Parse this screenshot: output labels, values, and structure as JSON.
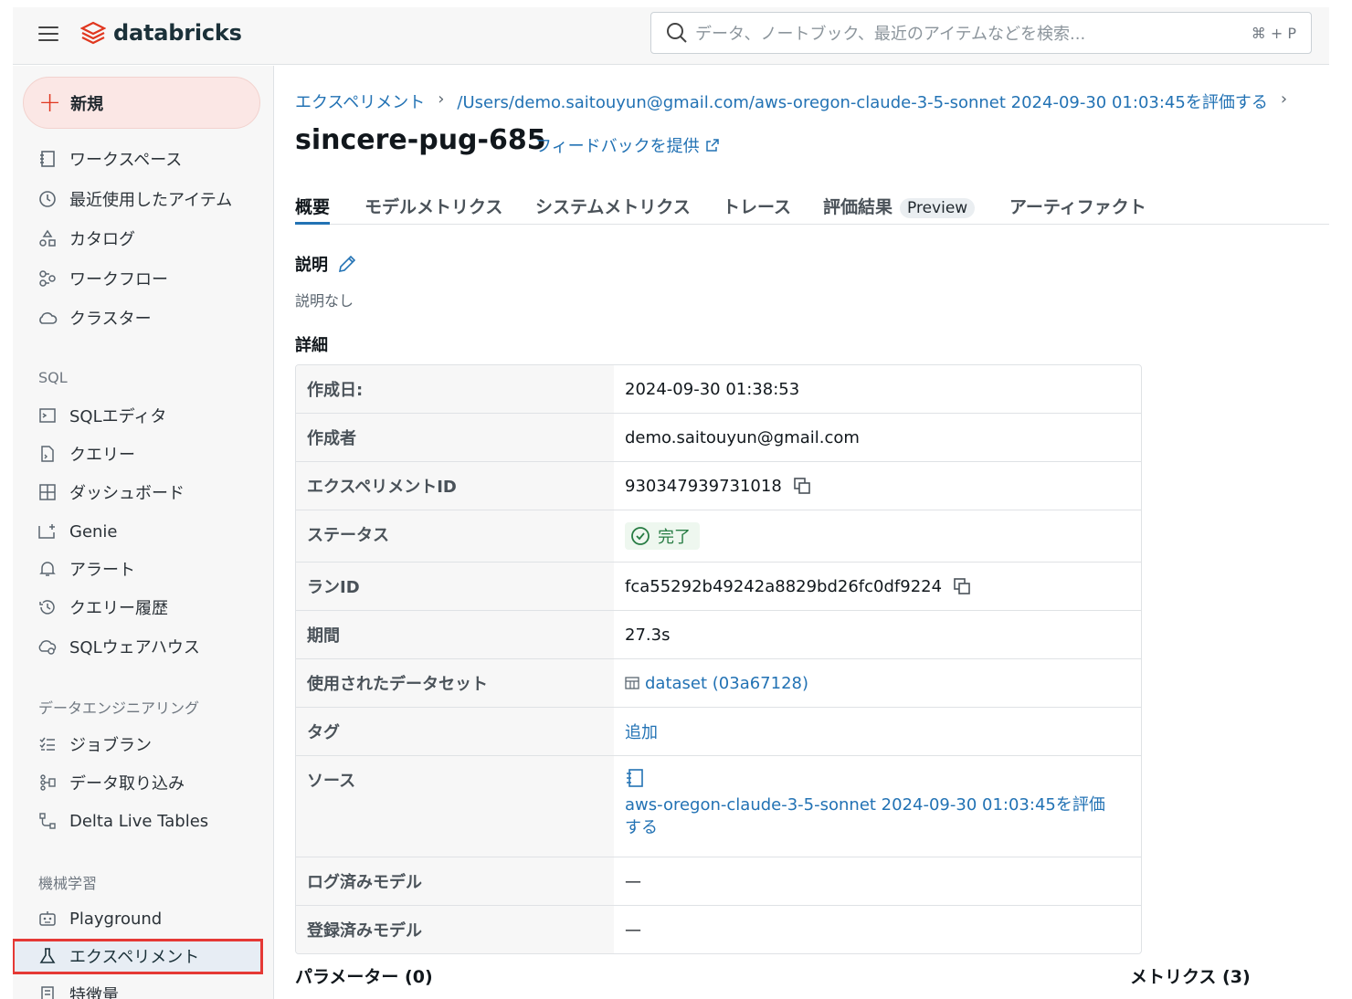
{
  "header": {
    "brand": "databricks",
    "search_placeholder": "データ、ノートブック、最近のアイテムなどを検索...",
    "search_shortcut": "⌘ + P"
  },
  "sidebar": {
    "new_label": "新規",
    "items": [
      {
        "label": "ワークスペース"
      },
      {
        "label": "最近使用したアイテム"
      },
      {
        "label": "カタログ"
      },
      {
        "label": "ワークフロー"
      },
      {
        "label": "クラスター"
      }
    ],
    "sql_section": "SQL",
    "sql_items": [
      {
        "label": "SQLエディタ"
      },
      {
        "label": "クエリー"
      },
      {
        "label": "ダッシュボード"
      },
      {
        "label": "Genie"
      },
      {
        "label": "アラート"
      },
      {
        "label": "クエリー履歴"
      },
      {
        "label": "SQLウェアハウス"
      }
    ],
    "de_section": "データエンジニアリング",
    "de_items": [
      {
        "label": "ジョブラン"
      },
      {
        "label": "データ取り込み"
      },
      {
        "label": "Delta Live Tables"
      }
    ],
    "ml_section": "機械学習",
    "ml_items": [
      {
        "label": "Playground"
      },
      {
        "label": "エクスペリメント"
      },
      {
        "label": "特徴量"
      }
    ]
  },
  "breadcrumb": {
    "root": "エクスペリメント",
    "sep": "›",
    "path": "/Users/demo.saitouyun@gmail.com/aws-oregon-claude-3-5-sonnet 2024-09-30 01:03:45を評価する"
  },
  "run": {
    "title": "sincere-pug-685",
    "feedback": "フィードバックを提供"
  },
  "tabs": [
    {
      "label": "概要"
    },
    {
      "label": "モデルメトリクス"
    },
    {
      "label": "システムメトリクス"
    },
    {
      "label": "トレース"
    },
    {
      "label": "評価結果",
      "badge": "Preview"
    },
    {
      "label": "アーティファクト"
    }
  ],
  "description": {
    "heading": "説明",
    "empty": "説明なし"
  },
  "details": {
    "heading": "詳細",
    "rows": [
      {
        "key": "作成日:",
        "value": "2024-09-30 01:38:53"
      },
      {
        "key": "作成者",
        "value": "demo.saitouyun@gmail.com"
      },
      {
        "key": "エクスペリメントID",
        "value": "930347939731018"
      },
      {
        "key": "ステータス",
        "value": "完了"
      },
      {
        "key": "ランID",
        "value": "fca55292b49242a8829bd26fc0df9224"
      },
      {
        "key": "期間",
        "value": "27.3s"
      },
      {
        "key": "使用されたデータセット",
        "value": "dataset (03a67128)"
      },
      {
        "key": "タグ",
        "value": "追加"
      },
      {
        "key": "ソース",
        "value": "aws-oregon-claude-3-5-sonnet 2024-09-30 01:03:45を評価する"
      },
      {
        "key": "ログ済みモデル",
        "value": "—"
      },
      {
        "key": "登録済みモデル",
        "value": "—"
      }
    ]
  },
  "params_heading": "パラメーター (0)",
  "metrics_heading": "メトリクス (3)"
}
